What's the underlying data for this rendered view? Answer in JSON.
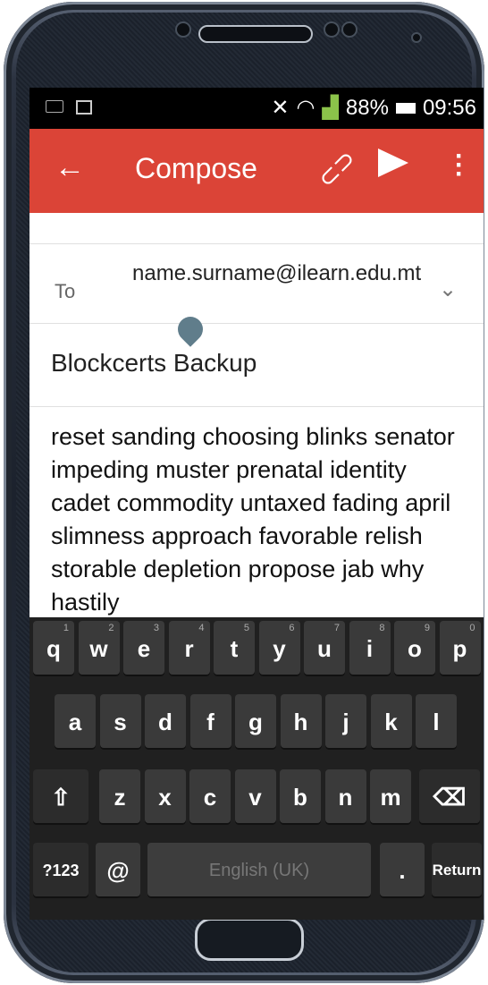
{
  "status_bar": {
    "battery": "88%",
    "time": "09:56"
  },
  "app_bar": {
    "title": "Compose",
    "back_icon": "arrow-back-icon",
    "attach_icon": "paperclip-icon",
    "send_icon": "send-icon",
    "more_icon": "more-vert-icon"
  },
  "compose": {
    "to_label": "To",
    "to_value": "name.surname@ilearn.edu.mt",
    "subject": "Blockcerts Backup",
    "body": "reset sanding choosing blinks senator impeding muster prenatal identity cadet commodity untaxed fading april slimness approach favorable relish storable depletion  propose jab why hastily"
  },
  "keyboard": {
    "row1": [
      "q",
      "w",
      "e",
      "r",
      "t",
      "y",
      "u",
      "i",
      "o",
      "p"
    ],
    "row1_numbers": [
      "1",
      "2",
      "3",
      "4",
      "5",
      "6",
      "7",
      "8",
      "9",
      "0"
    ],
    "row2": [
      "a",
      "s",
      "d",
      "f",
      "g",
      "h",
      "j",
      "k",
      "l"
    ],
    "row3": [
      "z",
      "x",
      "c",
      "v",
      "b",
      "n",
      "m"
    ],
    "symbols_label": "?123",
    "at_label": "@",
    "space_label": "English (UK)",
    "period_label": ".",
    "return_label": "Return"
  }
}
